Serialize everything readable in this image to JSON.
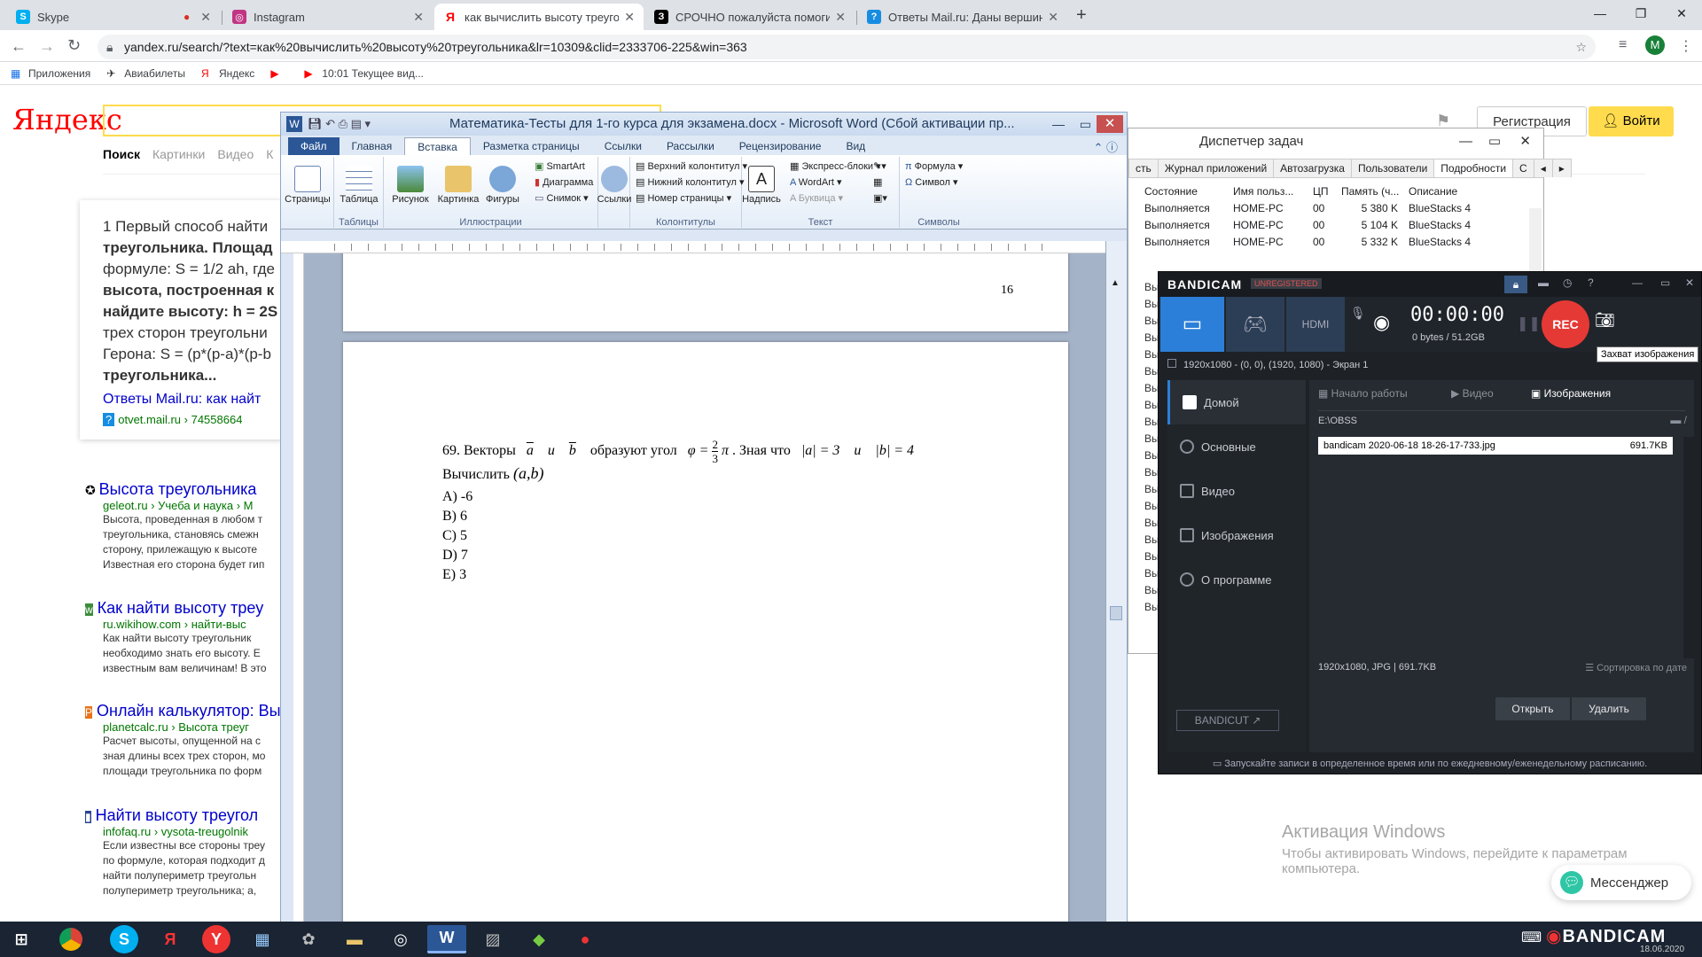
{
  "chrome": {
    "tabs": [
      {
        "title": "Skype",
        "icon": "skype-icon",
        "color": "#00aff0"
      },
      {
        "title": "Instagram",
        "icon": "instagram-icon",
        "color": "#c13584"
      },
      {
        "title": "как вычислить высоту треуголь",
        "icon": "yandex-icon",
        "color": "#ff0000"
      },
      {
        "title": "СРОЧНО пожалуйста помогите",
        "icon": "znanija-icon",
        "color": "#000000"
      },
      {
        "title": "Ответы Mail.ru: Даны вершины",
        "icon": "mailru-answers-icon",
        "color": "#168de2"
      }
    ],
    "url": "yandex.ru/search/?text=как%20вычислить%20высоту%20треугольника&lr=10309&clid=2333706-225&win=363",
    "profile_letter": "M",
    "bookmarks": [
      "Приложения",
      "Авиабилеты",
      "Яндекс",
      "",
      "10:01 Текущее вид..."
    ]
  },
  "yandex": {
    "logo": "Яндекс",
    "nav": [
      "Поиск",
      "Картинки",
      "Видео",
      "К"
    ],
    "register": "Регистрация",
    "login": "Войти",
    "answer_lines": [
      "1 Первый способ найти",
      "треугольника. Площад",
      "формуле: S = 1/2 ah, где",
      "высота, построенная к",
      "найдите высоту: h = 2S",
      "трех сторон треугольни",
      "Герона: S = (p*(p-a)*(p-b",
      "треугольника..."
    ],
    "answer_source_title": "Ответы Mail.ru: как найт",
    "answer_source_url": "otvet.mail.ru › 74558664",
    "results": [
      {
        "title": "Высота треугольника",
        "url": "geleot.ru › Учеба и наука › М",
        "snippet": [
          "Высота, проведенная в любом т",
          "треугольника, становясь смежн",
          "сторону, прилежащую к высоте",
          "Известная его сторона будет гип"
        ]
      },
      {
        "title": "Как найти высоту треу",
        "url": "ru.wikihow.com › найти-выс",
        "snippet": [
          "Как найти высоту треугольник",
          "необходимо знать его высоту. Е",
          "известным вам величинам! В это"
        ]
      },
      {
        "title": "Онлайн калькулятор: Вы",
        "url": "planetcalc.ru › Высота треуг",
        "snippet": [
          "Расчет высоты, опущенной на с",
          "зная длины всех трех сторон, мо",
          "площади треугольника по форм"
        ]
      },
      {
        "title": "Найти высоту треугол",
        "url": "infofaq.ru › vysota-treugolnik",
        "snippet": [
          "Если известны все стороны треу",
          "по формуле, которая подходит д",
          "найти полупериметр треугольн",
          "полупериметр треугольника; a,"
        ]
      }
    ]
  },
  "word": {
    "title": "Математика-Тесты для 1-го курса для экзамена.docx - Microsoft Word (Сбой активации пр...",
    "tabs": [
      "Файл",
      "Главная",
      "Вставка",
      "Разметка страницы",
      "Ссылки",
      "Рассылки",
      "Рецензирование",
      "Вид"
    ],
    "groups": [
      "Таблицы",
      "Иллюстрации",
      "Колонтитулы",
      "Текст",
      "Символы"
    ],
    "buttons": {
      "pages": "Страницы",
      "table": "Таблица",
      "picture": "Рисунок",
      "clipart": "Картинка",
      "shapes": "Фигуры",
      "smartart": "SmartArt",
      "chart": "Диаграмма",
      "screenshot": "Снимок",
      "links": "Ссылки",
      "header": "Верхний колонтитул",
      "footer": "Нижний колонтитул",
      "page_number": "Номер страницы",
      "textbox": "Надпись",
      "quickparts": "Экспресс-блоки",
      "wordart": "WordArt",
      "dropcap": "Буквица",
      "equation": "Формула",
      "symbol": "Символ"
    },
    "page_number": "16",
    "question": {
      "num": "69. Векторы",
      "va": "a",
      "and1": "и",
      "vb": "b",
      "form": "образуют угол",
      "phi": "φ =",
      "frac_num": "2",
      "frac_den": "3",
      "pi": "π",
      "known": ". Зная что",
      "abs_a": "|a| = 3",
      "and2": "и",
      "abs_b": "|b| = 4",
      "compute": "Вычислить",
      "pair": "(a,b)"
    },
    "options": [
      "A) -6",
      "B) 6",
      "C) 5",
      "D) 7",
      "E) 3"
    ]
  },
  "taskmgr": {
    "title": "Диспетчер задач",
    "tabs": [
      "сть",
      "Журнал приложений",
      "Автозагрузка",
      "Пользователи",
      "Подробности",
      "С"
    ],
    "columns": [
      "Состояние",
      "Имя польз...",
      "ЦП",
      "Память (ч...",
      "Описание"
    ],
    "rows": [
      [
        "Выполняется",
        "HOME-PC",
        "00",
        "5 380 K",
        "BlueStacks 4"
      ],
      [
        "Выполняется",
        "HOME-PC",
        "00",
        "5 104 K",
        "BlueStacks 4"
      ],
      [
        "Выполняется",
        "HOME-PC",
        "00",
        "5 332 K",
        "BlueStacks 4"
      ]
    ],
    "left_stub": "Вы"
  },
  "bandicam": {
    "logo": "BANDICAM",
    "unreg": "UNREGISTERED",
    "timer": "00:00:00",
    "size": "0 bytes / 51.2GB",
    "rec": "REC",
    "tooltip": "Захват изображения",
    "target": "1920x1080 - (0, 0), (1920, 1080) - Экран 1",
    "menu": [
      "Домой",
      "Основные",
      "Видео",
      "Изображения",
      "О программе"
    ],
    "subtabs": [
      "Начало работы",
      "Видео",
      "Изображения"
    ],
    "path": "E:\\OBSS",
    "file_name": "bandicam 2020-06-18 18-26-17-733.jpg",
    "file_size": "691.7KB",
    "info": "1920x1080, JPG | 691.7KB",
    "sort": "Сортировка по дате",
    "bandicut": "BANDICUT ↗",
    "open": "Открыть",
    "delete": "Удалить",
    "footer": "Запускайте записи в определенное время или по ежедневному/еженедельному расписанию."
  },
  "activation": {
    "title": "Активация Windows",
    "line1": "Чтобы активировать Windows, перейдите к параметрам",
    "line2": "компьютера."
  },
  "messenger": "Мессенджер",
  "taskbar": {
    "watermark": "BANDICAM",
    "date": "18.06.2020"
  }
}
